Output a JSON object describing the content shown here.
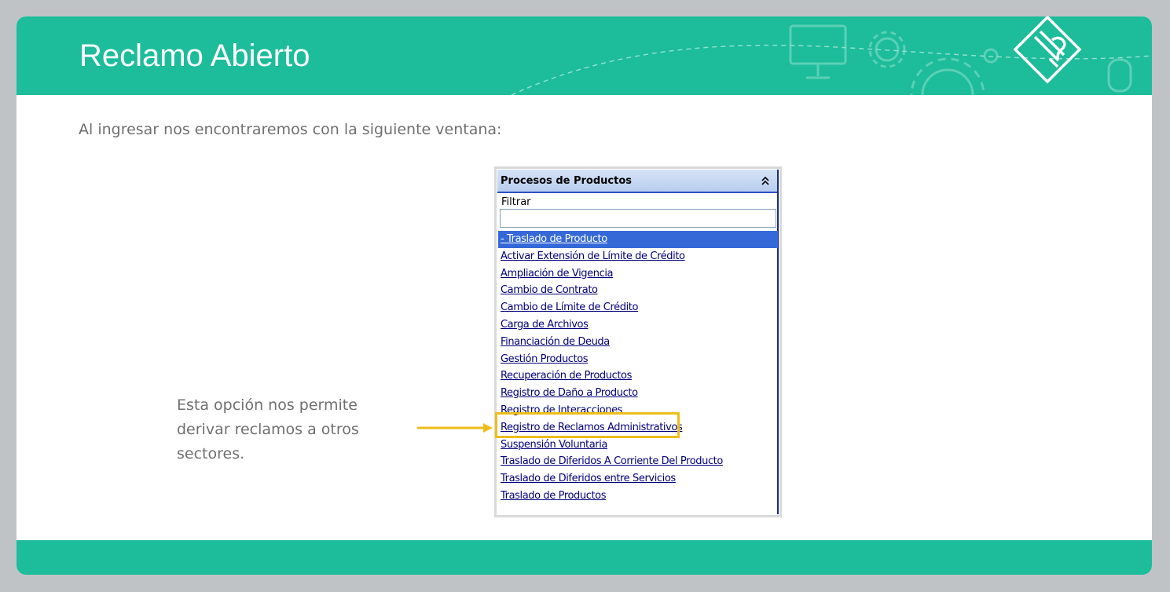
{
  "slide": {
    "title": "Reclamo Abierto",
    "intro": "Al ingresar nos encontraremos con la siguiente ventana:",
    "note": "Esta opción nos permite derivar reclamos a otros sectores."
  },
  "panel": {
    "title": "Procesos de Productos",
    "filter_label": "Filtrar",
    "filter_value": "",
    "items": [
      "- Traslado de Producto",
      "Activar Extensión de Límite de Crédito",
      "Ampliación de Vigencia",
      "Cambio de Contrato",
      "Cambio de Límite de Crédito",
      "Carga de Archivos",
      "Financiación de Deuda",
      "Gestión Productos",
      "Recuperación de Productos",
      "Registro de Daño a Producto",
      "Registro de Interacciones",
      "Registro de Reclamos Administrativos",
      "Suspensión Voluntaria",
      "Traslado de Diferidos A Corriente Del Producto",
      "Traslado de Diferidos entre Servicios",
      "Traslado de Productos"
    ],
    "selected_item": "- Traslado de Producto",
    "highlighted_item": "Registro de Reclamos Administrativos"
  },
  "colors": {
    "accent": "#1dbc9b",
    "highlight": "#eebd1b",
    "selection": "#3569d8"
  }
}
